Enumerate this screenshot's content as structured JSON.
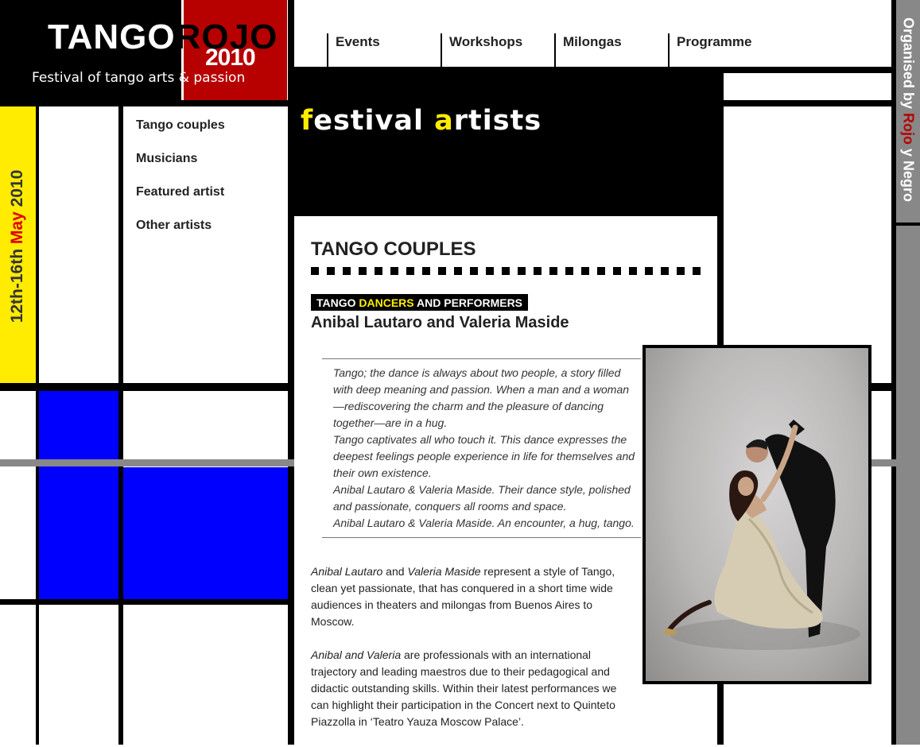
{
  "logo": {
    "tango": "TANGO",
    "rojo": "ROJO",
    "year": "2010",
    "tagline": "Festival of tango arts & passion"
  },
  "nav": {
    "items": [
      {
        "label": "Events"
      },
      {
        "label": "Workshops"
      },
      {
        "label": "Milongas"
      },
      {
        "label": "Programme"
      }
    ]
  },
  "dates": {
    "prefix": "12th-16th ",
    "month": "May",
    "year": " 2010"
  },
  "organiser": {
    "prefix": "Organised by ",
    "rojo": "Rojo",
    "suffix": " y Negro"
  },
  "side_menu": {
    "items": [
      {
        "label": "Tango couples"
      },
      {
        "label": "Musicians"
      },
      {
        "label": "Featured artist"
      },
      {
        "label": "Other artists"
      }
    ]
  },
  "header": {
    "title_f": "f",
    "title_mid": "estival ",
    "title_a": "a",
    "title_end": "rtists"
  },
  "section": {
    "title": "TANGO COUPLES",
    "badge_pre": "TANGO ",
    "badge_hl": "DANCERS",
    "badge_post": " AND PERFORMERS",
    "artist": "Anibal Lautaro and Valeria Maside"
  },
  "quote": {
    "lines": [
      "Tango; the dance is always about two people, a story filled with deep meaning and passion. When a man and a woman —rediscovering the charm and the pleasure of dancing together—are in a hug.",
      "Tango captivates all who touch it. This dance expresses the deepest feelings people experience in life for themselves and their own existence.",
      "Anibal Lautaro & Valeria Maside. Their dance style, polished and passionate, conquers all rooms and space.",
      "Anibal Lautaro & Valeria Maside. An encounter, a hug, tango."
    ]
  },
  "body": {
    "p1_name1": "Anibal Lautaro",
    "p1_and": " and ",
    "p1_name2": "Valeria Maside",
    "p1_rest": " represent a style of Tango, clean yet passionate, that has conquered in a short time wide audiences in theaters and milongas from Buenos Aires to Moscow.",
    "p2_names": "Anibal and Valeria",
    "p2_rest": " are professionals with an international trajectory and leading maestros due to their pedagogical and didactic outstanding skills. Within their latest performances we can highlight their participation in the Concert next to Quinteto Piazzolla in ‘Teatro Yauza Moscow Palace’."
  },
  "colors": {
    "yellow": "#ffec00",
    "red": "#b70000",
    "blue": "#0000ff",
    "gray": "#888888",
    "black": "#000000"
  }
}
